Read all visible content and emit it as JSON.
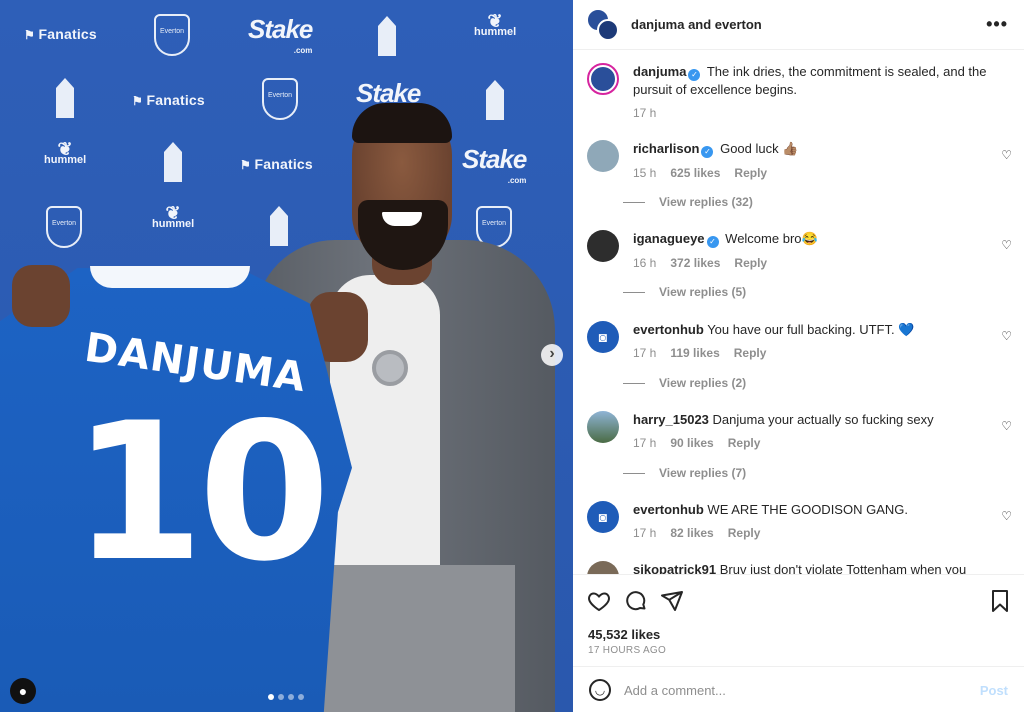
{
  "photo": {
    "sponsors": {
      "fanatics": "Fanatics",
      "stake": "Stake",
      "stake_sub": ".com",
      "hummel": "hummel",
      "crest": "Everton"
    },
    "jersey_name": "DANJUMA",
    "jersey_number": "10",
    "carousel_count": 4,
    "carousel_active": 0
  },
  "header": {
    "title": "danjuma and everton",
    "more_label": "•••"
  },
  "caption": {
    "user": "danjuma",
    "text": "The ink dries, the commitment is sealed, and the pursuit of excellence begins.",
    "time": "17 h"
  },
  "comments": [
    {
      "user": "richarlison",
      "verified": true,
      "text": "Good luck 👍🏽",
      "time": "15 h",
      "likes": "625 likes",
      "reply": "Reply",
      "replies": "View replies (32)"
    },
    {
      "user": "iganagueye",
      "verified": true,
      "text": "Welcome bro😂",
      "time": "16 h",
      "likes": "372 likes",
      "reply": "Reply",
      "replies": "View replies (5)"
    },
    {
      "user": "evertonhub",
      "verified": false,
      "text": "You have our full backing. UTFT. 💙",
      "time": "17 h",
      "likes": "119 likes",
      "reply": "Reply",
      "replies": "View replies (2)"
    },
    {
      "user": "harry_15023",
      "verified": false,
      "text": "Danjuma your actually so fucking sexy",
      "time": "17 h",
      "likes": "90 likes",
      "reply": "Reply",
      "replies": "View replies (7)"
    },
    {
      "user": "evertonhub",
      "verified": false,
      "text": "WE ARE THE GOODISON GANG.",
      "time": "17 h",
      "likes": "82 likes",
      "reply": "Reply",
      "replies": ""
    },
    {
      "user": "sikopatrick91",
      "verified": false,
      "text": "Bruv just don't violate Tottenham when you",
      "time": "",
      "likes": "",
      "reply": "",
      "replies": ""
    }
  ],
  "actions": {
    "likes": "45,532 likes",
    "time_ago": "17 HOURS AGO"
  },
  "compose": {
    "placeholder": "Add a comment...",
    "post_label": "Post"
  },
  "icons": {
    "heart": "heart-icon",
    "comment": "comment-icon",
    "share": "paper-plane-icon",
    "save": "bookmark-icon",
    "emoji": "smiley-icon",
    "next": "chevron-right-icon"
  },
  "colors": {
    "instagram_blue": "#3897f0",
    "post_disabled": "#c0dffd",
    "everton_blue": "#1d63c4"
  }
}
